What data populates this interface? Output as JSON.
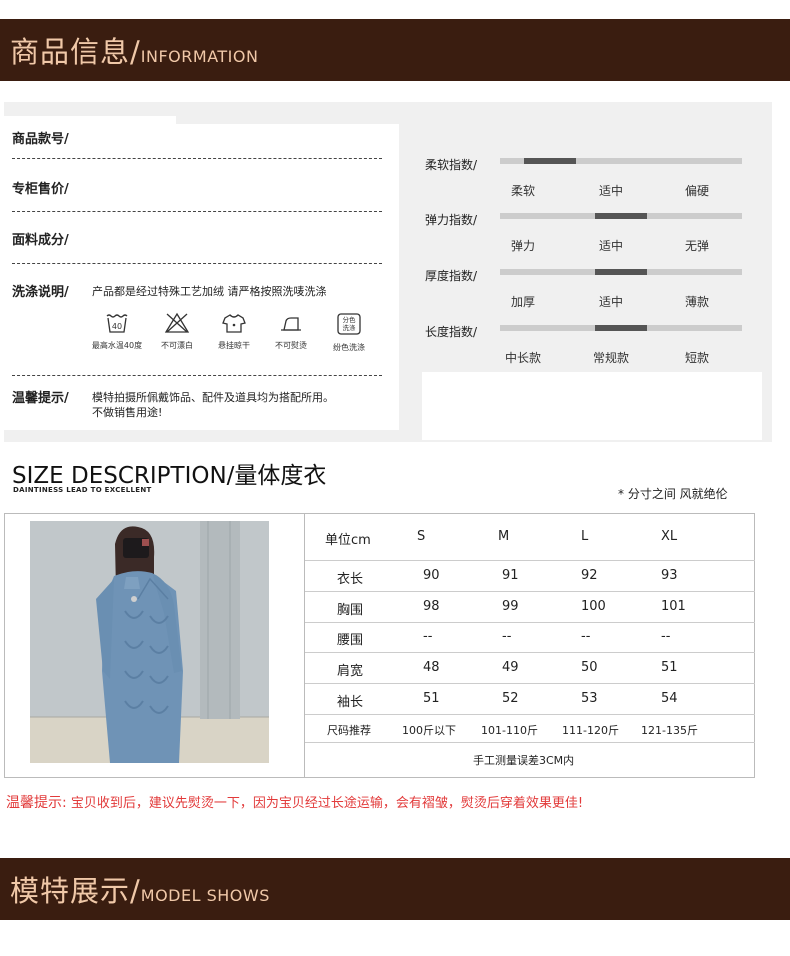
{
  "banner_info": {
    "cn": "商品信息/",
    "en": "INFORMATION"
  },
  "info": {
    "rows": [
      {
        "label": "商品款号/",
        "value": ""
      },
      {
        "label": "专柜售价/",
        "value": ""
      },
      {
        "label": "面料成分/",
        "value": ""
      },
      {
        "label": "洗涤说明/",
        "value": "产品都是经过特殊工艺加绒 请严格按照洗唛洗涤"
      },
      {
        "label": "温馨提示/",
        "value": "模特拍摄所佩戴饰品、配件及道具均为搭配所用。",
        "value2": "不做销售用途!"
      }
    ],
    "wash_icons": [
      {
        "icon": "wash-40-icon",
        "text": "40",
        "caption": "最高水温40度"
      },
      {
        "icon": "no-bleach-icon",
        "caption": "不可漂白"
      },
      {
        "icon": "hang-dry-icon",
        "caption": "悬挂晾干"
      },
      {
        "icon": "no-iron-icon",
        "caption": "不可熨烫"
      },
      {
        "icon": "separate-wash-icon",
        "text": "分色洗涤",
        "caption": "纷色洗涤"
      }
    ]
  },
  "indices": [
    {
      "title": "柔软指数/",
      "options": [
        "柔软",
        "适中",
        "偏硬"
      ],
      "level": 0.1
    },
    {
      "title": "弹力指数/",
      "options": [
        "弹力",
        "适中",
        "无弹"
      ],
      "level": 0.5
    },
    {
      "title": "厚度指数/",
      "options": [
        "加厚",
        "适中",
        "薄款"
      ],
      "level": 0.5
    },
    {
      "title": "长度指数/",
      "options": [
        "中长款",
        "常规款",
        "短款"
      ],
      "level": 0.5
    }
  ],
  "size": {
    "title": "SIZE DESCRIPTION/量体度衣",
    "subtitle": "DAINTINESS LEAD TO EXCELLENT",
    "note": "* 分寸之间 风就绝伦",
    "header": [
      "单位cm",
      "S",
      "M",
      "L",
      "XL"
    ],
    "rows": [
      [
        "衣长",
        "90",
        "91",
        "92",
        "93"
      ],
      [
        "胸围",
        "98",
        "99",
        "100",
        "101"
      ],
      [
        "腰围",
        "--",
        "--",
        "--",
        "--"
      ],
      [
        "肩宽",
        "48",
        "49",
        "50",
        "51"
      ],
      [
        "袖长",
        "51",
        "52",
        "53",
        "54"
      ],
      [
        "尺码推荐",
        "100斤以下",
        "101-110斤",
        "111-120斤",
        "121-135斤"
      ]
    ],
    "footer": "手工测量误差3CM内"
  },
  "tip": {
    "label": "温馨提示:",
    "text": "宝贝收到后，建议先熨烫一下，因为宝贝经过长途运输，会有褶皱，熨烫后穿着效果更佳!"
  },
  "banner_model": {
    "cn": "模特展示/",
    "en": "MODEL SHOWS"
  },
  "colors": {
    "banner_bg": "#3a1d10",
    "banner_text": "#f0c8a8",
    "tip": "#e23a3a",
    "sweater": "#6f93b6"
  }
}
